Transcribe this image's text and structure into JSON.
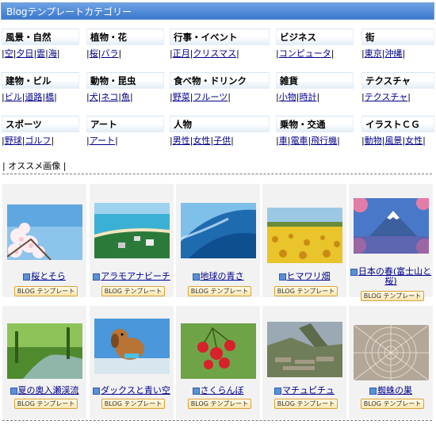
{
  "title": "Blogテンプレートカテゴリー",
  "categories": [
    {
      "name": "風景・自然",
      "links": [
        "空",
        "夕日",
        "雲",
        "海"
      ]
    },
    {
      "name": "植物・花",
      "links": [
        "桜",
        "バラ"
      ]
    },
    {
      "name": "行事・イベント",
      "links": [
        "正月",
        "クリスマス"
      ]
    },
    {
      "name": "ビジネス",
      "links": [
        "コンピュータ"
      ]
    },
    {
      "name": "街",
      "links": [
        "東京",
        "沖縄"
      ]
    },
    {
      "name": "建物・ビル",
      "links": [
        "ビル",
        "道路",
        "橋"
      ]
    },
    {
      "name": "動物・昆虫",
      "links": [
        "犬",
        "ネコ",
        "魚"
      ]
    },
    {
      "name": "食べ物・ドリンク",
      "links": [
        "野菜",
        "フルーツ"
      ]
    },
    {
      "name": "雑貨",
      "links": [
        "小物",
        "時計"
      ]
    },
    {
      "name": "テクスチャ",
      "links": [
        "テクスチャ"
      ]
    },
    {
      "name": "スポーツ",
      "links": [
        "野球",
        "ゴルフ"
      ]
    },
    {
      "name": "アート",
      "links": [
        "アート"
      ]
    },
    {
      "name": "人物",
      "links": [
        "男性",
        "女性",
        "子供"
      ]
    },
    {
      "name": "乗物・交通",
      "links": [
        "車",
        "電車",
        "飛行機"
      ]
    },
    {
      "name": "イラストＣＧ",
      "links": [
        "動物",
        "風景",
        "女性"
      ]
    }
  ],
  "recommend": "オススメ画像",
  "badge": "BLOG テンプレート",
  "thumbs": [
    {
      "caption": "桜とそら",
      "icon": "cherry-blossom-sky"
    },
    {
      "caption": "アラモアナビーチ",
      "icon": "beach-aerial"
    },
    {
      "caption": "地球の青さ",
      "icon": "blue-earth"
    },
    {
      "caption": "ヒマワリ畑",
      "icon": "sunflower-field"
    },
    {
      "caption": "日本の春(富士山と桜)",
      "icon": "mount-fuji"
    },
    {
      "caption": "夏の奥入瀬渓流",
      "icon": "forest-stream"
    },
    {
      "caption": "ダックスと青い空",
      "icon": "dachshund"
    },
    {
      "caption": "さくらんぼ",
      "icon": "cherries"
    },
    {
      "caption": "マチュピチュ",
      "icon": "machu-picchu"
    },
    {
      "caption": "蜘蛛の巣",
      "icon": "spider-web"
    }
  ]
}
